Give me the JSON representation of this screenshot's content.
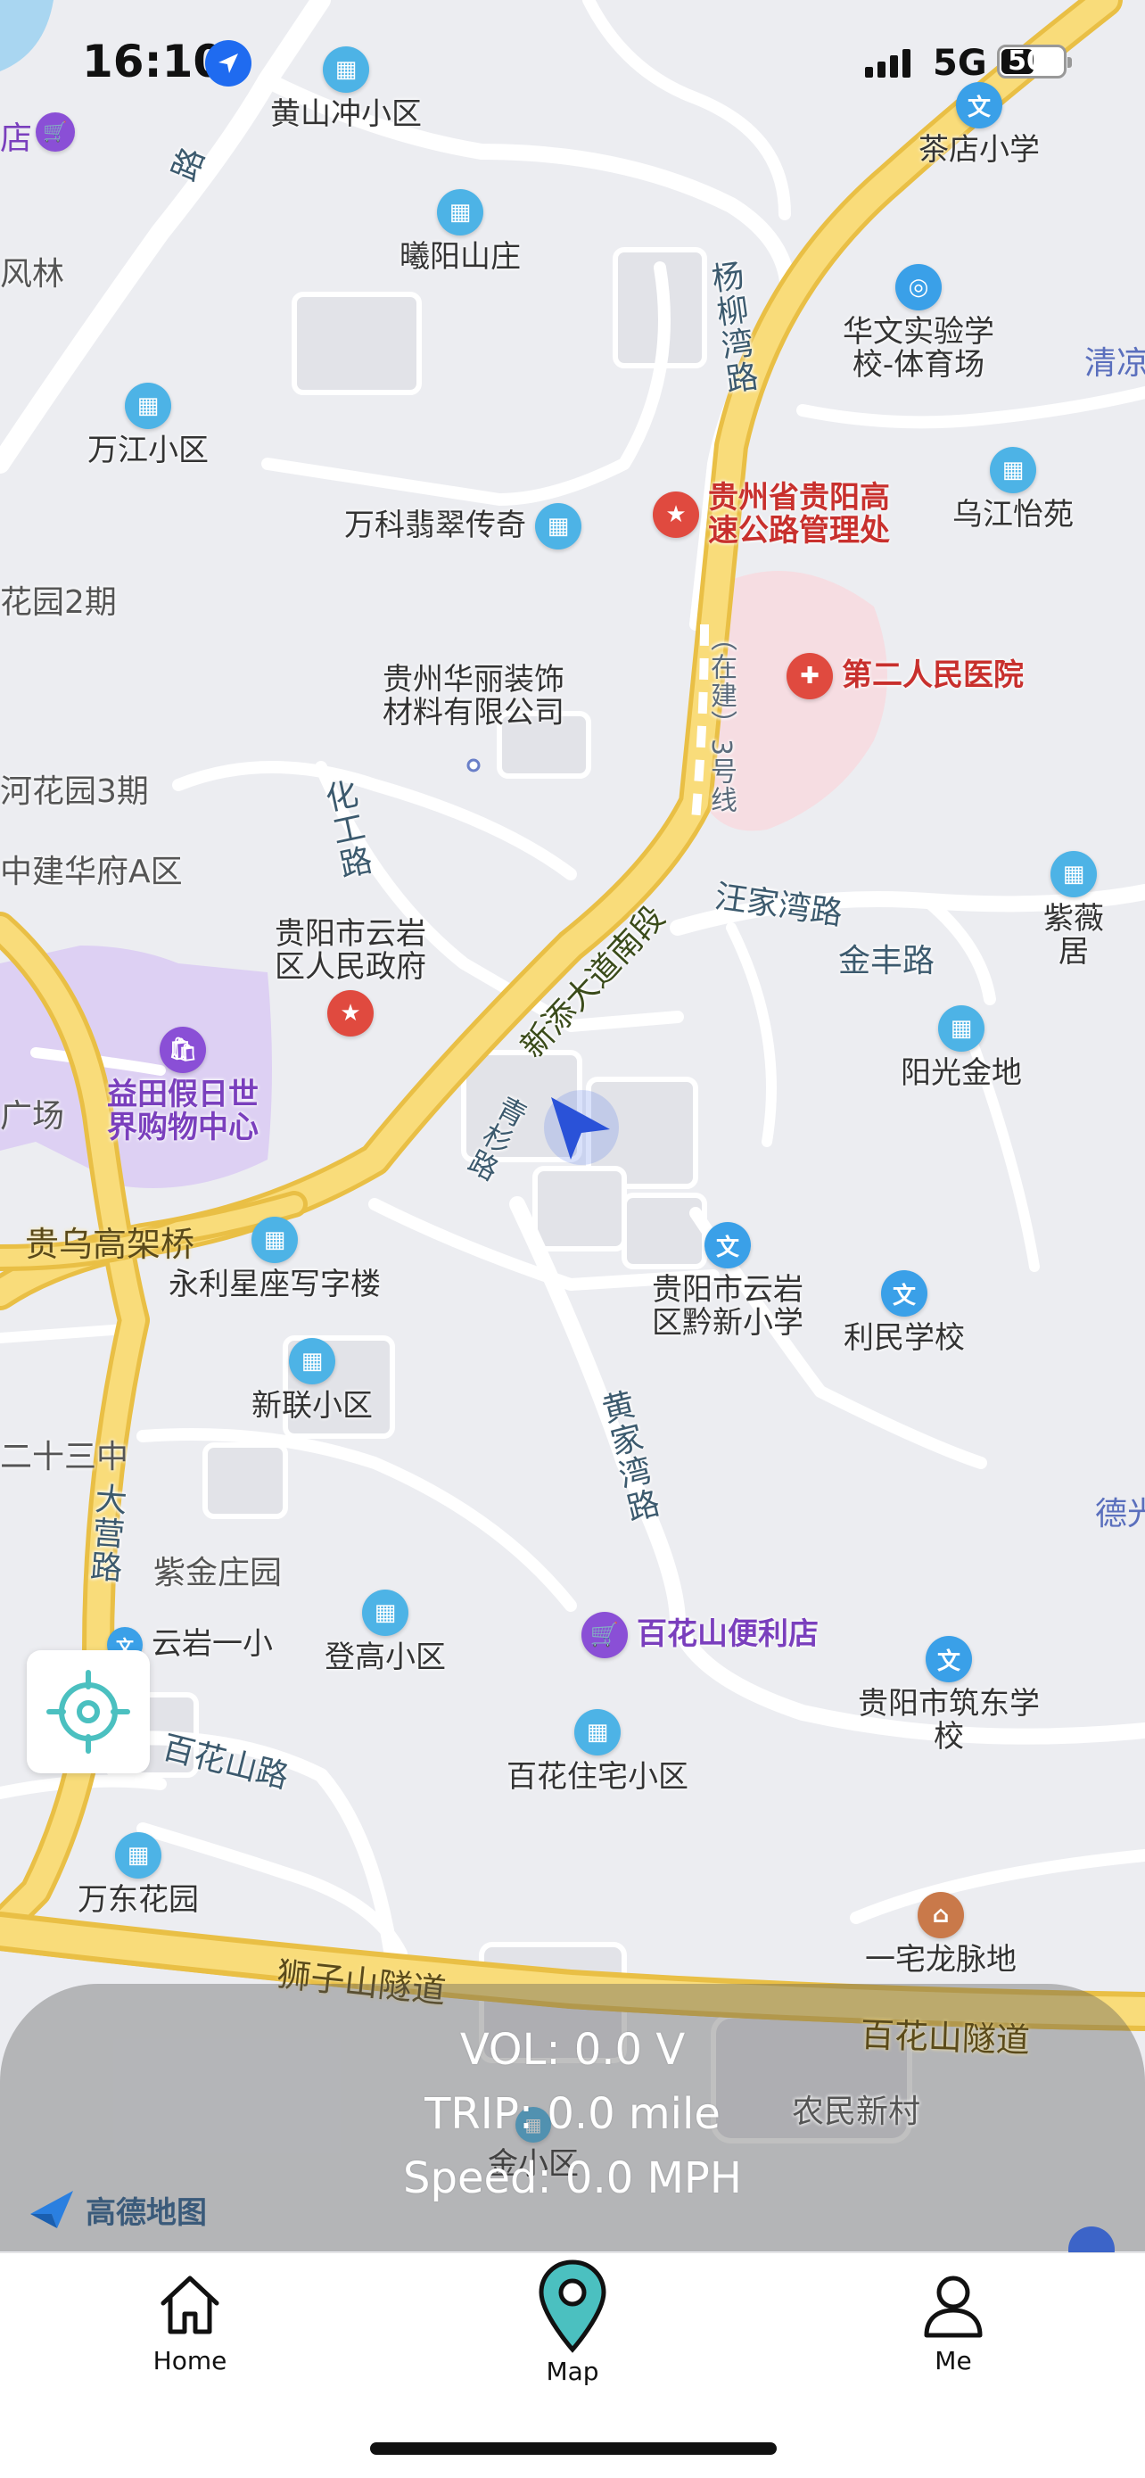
{
  "status_bar": {
    "time": "16:10",
    "network": "5G",
    "battery": "50"
  },
  "map": {
    "pois": [
      {
        "name": "黄山冲小区",
        "icon": "residential-icon"
      },
      {
        "name": "茶店小学",
        "icon": "school-icon"
      },
      {
        "name": "曦阳山庄",
        "icon": "residential-icon"
      },
      {
        "name": "华文实验学\n校-体育场",
        "icon": "sports-icon"
      },
      {
        "name": "万江小区",
        "icon": "residential-icon"
      },
      {
        "name": "万科翡翠传奇",
        "icon": "residential-icon"
      },
      {
        "name": "贵州省贵阳高\n速公路管理处",
        "icon": "government-icon"
      },
      {
        "name": "乌江怡苑",
        "icon": "residential-icon"
      },
      {
        "name": "第二人民医院",
        "icon": "hospital-icon"
      },
      {
        "name": "贵州华丽装饰\n材料有限公司",
        "icon": "company-dot"
      },
      {
        "name": "紫薇居",
        "icon": "residential-icon"
      },
      {
        "name": "贵阳市云岩\n区人民政府",
        "icon": "government-icon"
      },
      {
        "name": "阳光金地",
        "icon": "residential-icon"
      },
      {
        "name": "益田假日世\n界购物中心",
        "icon": "shopping-icon"
      },
      {
        "name": "永利星座写字楼",
        "icon": "office-icon"
      },
      {
        "name": "贵阳市云岩\n区黔新小学",
        "icon": "school-icon"
      },
      {
        "name": "利民学校",
        "icon": "school-icon"
      },
      {
        "name": "新联小区",
        "icon": "residential-icon"
      },
      {
        "name": "登高小区",
        "icon": "residential-icon"
      },
      {
        "name": "百花山便利店",
        "icon": "shopping-icon"
      },
      {
        "name": "贵阳市筑东学校",
        "icon": "school-icon"
      },
      {
        "name": "百花住宅小区",
        "icon": "residential-icon"
      },
      {
        "name": "万东花园",
        "icon": "residential-icon"
      },
      {
        "name": "一宅龙脉地",
        "icon": "landmark-icon"
      },
      {
        "name": "云岩一小",
        "icon": "school-icon"
      },
      {
        "name": "金小区",
        "icon": "residential-icon"
      }
    ],
    "areas": [
      "风林",
      "花园2期",
      "河花园3期",
      "中建华府A区",
      "紫金庄园",
      "二十三中",
      "农民新村",
      "广场"
    ],
    "roads": [
      "杨柳湾路",
      "化工路",
      "新添大道南段",
      "汪家湾路",
      "金丰路",
      "黄家湾路",
      "百花山路",
      "大营路",
      "青杉路",
      "路"
    ],
    "highways": [
      "贵乌高架桥",
      "狮子山隧道",
      "百花山隧道",
      "（在建）3号线"
    ],
    "edge_labels": [
      "清凉",
      "德光",
      "店"
    ],
    "brand": "高德地图"
  },
  "stats": {
    "vol": "VOL: 0.0 V",
    "trip": "TRIP: 0.0 mile",
    "speed": "Speed: 0.0 MPH"
  },
  "tabs": [
    {
      "label": "Home",
      "icon": "home-icon"
    },
    {
      "label": "Map",
      "icon": "map-pin-icon"
    },
    {
      "label": "Me",
      "icon": "person-icon"
    }
  ],
  "colors": {
    "highway": "#f7d66a",
    "accent": "#4bc0c0",
    "residential": "#4db3e6",
    "school": "#3aa0e8",
    "government": "#e04a3f",
    "shopping": "#8a4fd6",
    "user_marker": "#2a52d8"
  }
}
